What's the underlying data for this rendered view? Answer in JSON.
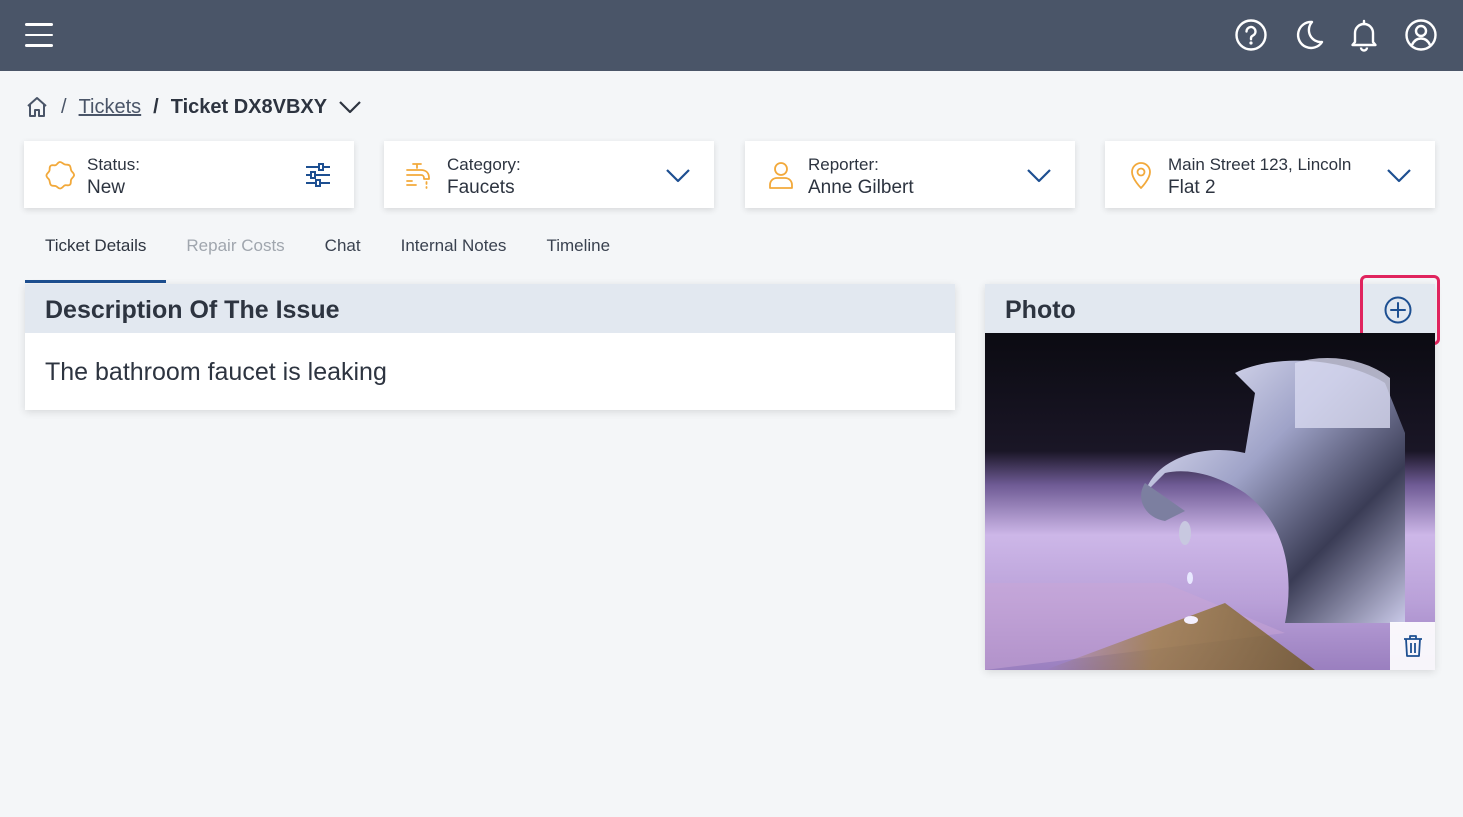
{
  "topbar": {
    "icons": [
      "menu-icon",
      "help-icon",
      "moon-icon",
      "bell-icon",
      "user-icon"
    ]
  },
  "breadcrumb": {
    "separator": "/",
    "link": "Tickets",
    "current": "Ticket DX8VBXY"
  },
  "cards": {
    "status": {
      "label": "Status:",
      "value": "New"
    },
    "category": {
      "label": "Category:",
      "value": "Faucets"
    },
    "reporter": {
      "label": "Reporter:",
      "value": "Anne Gilbert"
    },
    "address": {
      "line1": "Main Street 123, Lincoln",
      "line2": "Flat 2"
    }
  },
  "tabs": [
    "Ticket Details",
    "Repair Costs",
    "Chat",
    "Internal Notes",
    "Timeline"
  ],
  "description": {
    "title": "Description Of The Issue",
    "text": "The bathroom faucet is leaking"
  },
  "photo": {
    "title": "Photo"
  },
  "colors": {
    "topbar": "#4a5568",
    "accent": "#1d4f91",
    "card_icon": "#f2a93b",
    "highlight": "#e0245e",
    "panel_header": "#e2e8f0"
  }
}
